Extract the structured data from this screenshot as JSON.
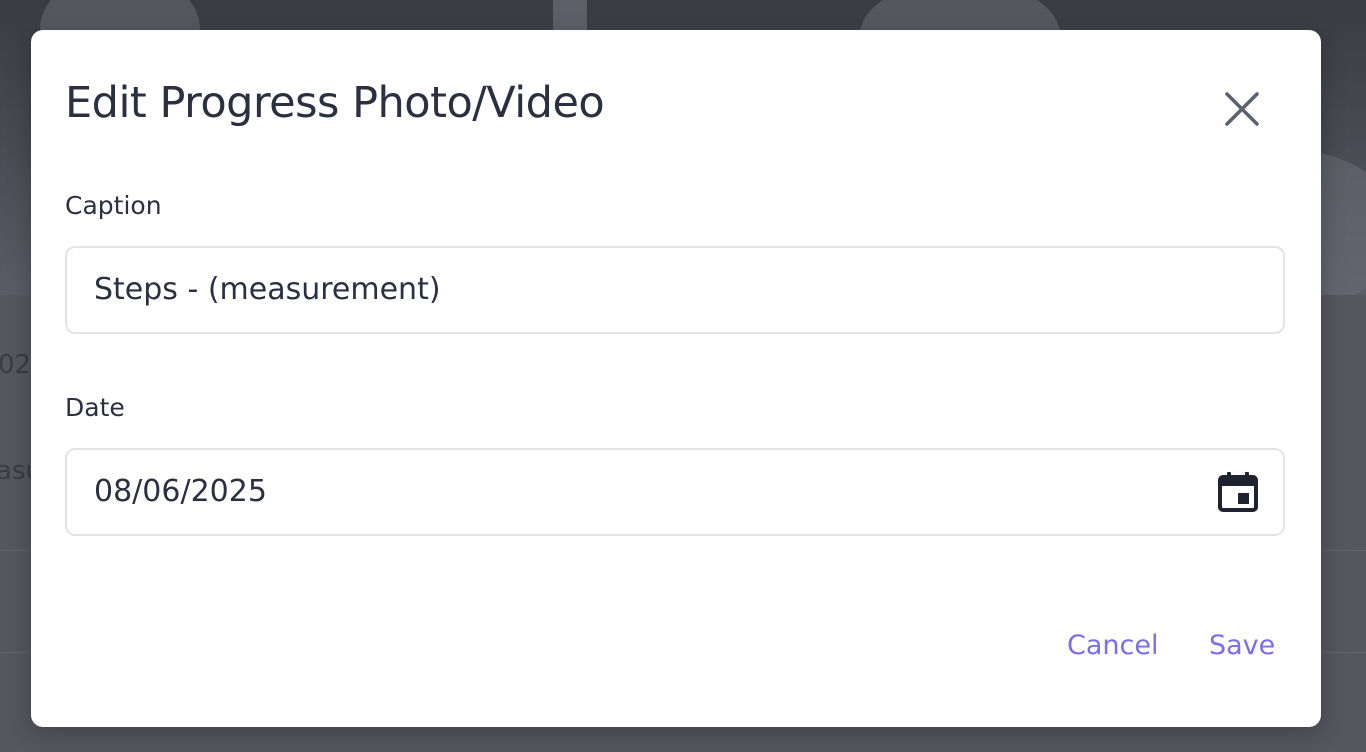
{
  "dialog": {
    "title": "Edit Progress Photo/Video",
    "close_icon": "close-icon",
    "caption": {
      "label": "Caption",
      "value": "Steps - (measurement)"
    },
    "date": {
      "label": "Date",
      "value": "08/06/2025",
      "icon": "calendar-icon"
    },
    "actions": {
      "cancel_label": "Cancel",
      "save_label": "Save"
    }
  },
  "background": {
    "fragment_1": "02",
    "fragment_2": "asu"
  },
  "colors": {
    "accent": "#7a6df0",
    "text": "#2b3040",
    "overlay": "#4b4d54",
    "dialog_bg": "#ffffff",
    "input_border": "#e3e4e8"
  }
}
